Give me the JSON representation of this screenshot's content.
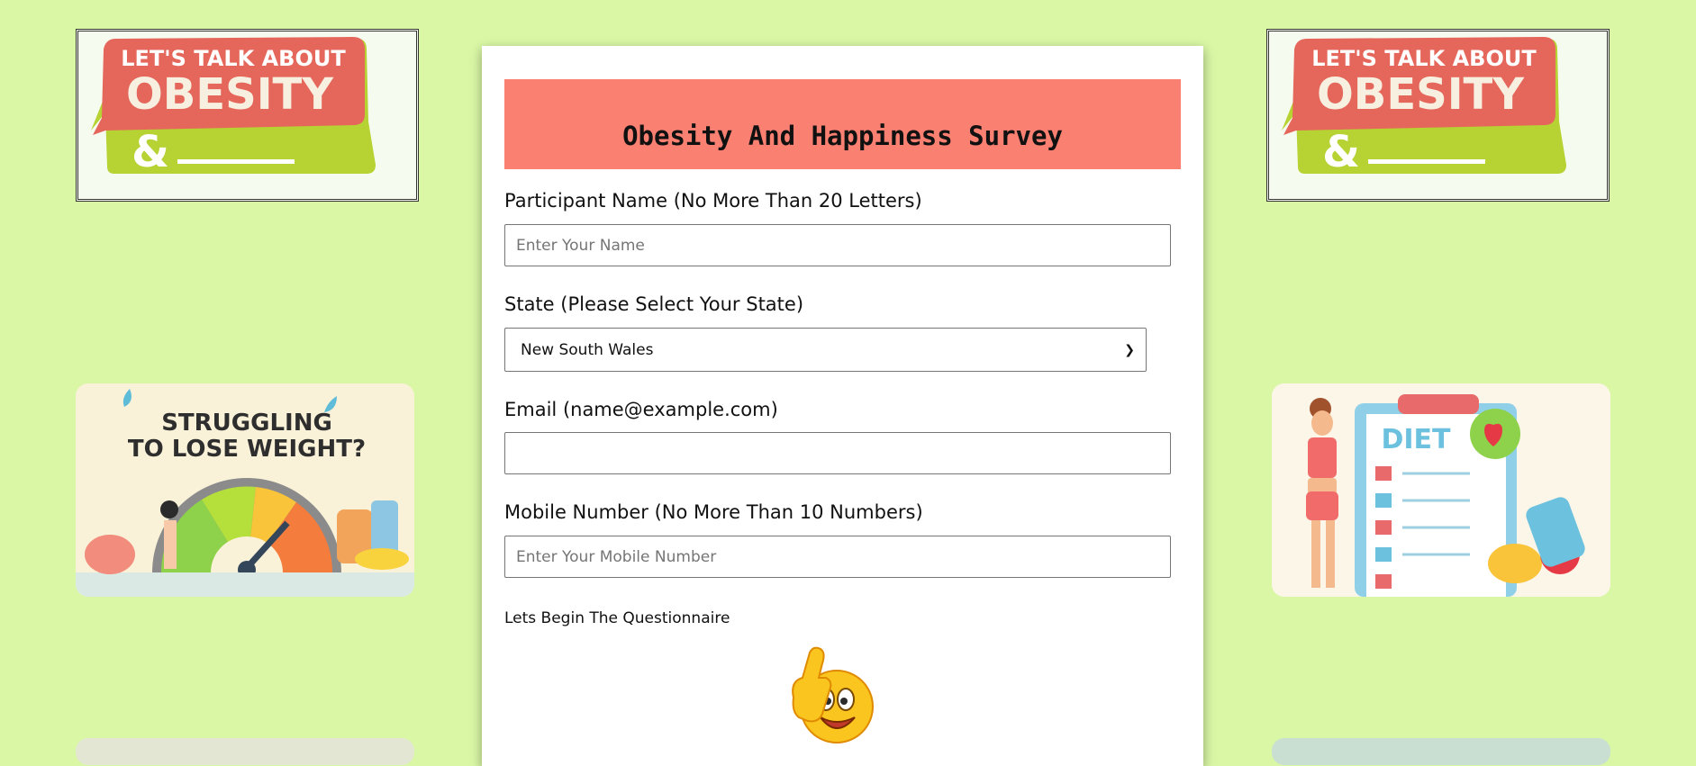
{
  "colors": {
    "page_bg": "#d9f7a5",
    "header_bg": "#fa8072",
    "card_bg": "#ffffff"
  },
  "left_column": {
    "banner": {
      "line1": "LET'S TALK ABOUT",
      "line2": "OBESITY",
      "line3": "&"
    },
    "poster": {
      "line1": "STRUGGLING",
      "line2": "TO LOSE WEIGHT?"
    }
  },
  "right_column": {
    "banner": {
      "line1": "LET'S TALK ABOUT",
      "line2": "OBESITY",
      "line3": "&"
    },
    "poster": {
      "word": "DIET"
    }
  },
  "survey": {
    "title": "Obesity And Happiness Survey",
    "name_label": "Participant Name (No More Than 20 Letters)",
    "name_placeholder": "Enter Your Name",
    "state_label": "State (Please Select Your State)",
    "state_selected": "New South Wales",
    "email_label": "Email (name@example.com)",
    "email_value": "",
    "mobile_label": "Mobile Number (No More Than 10 Numbers)",
    "mobile_placeholder": "Enter Your Mobile Number",
    "begin_text": "Lets Begin The Questionnaire"
  }
}
